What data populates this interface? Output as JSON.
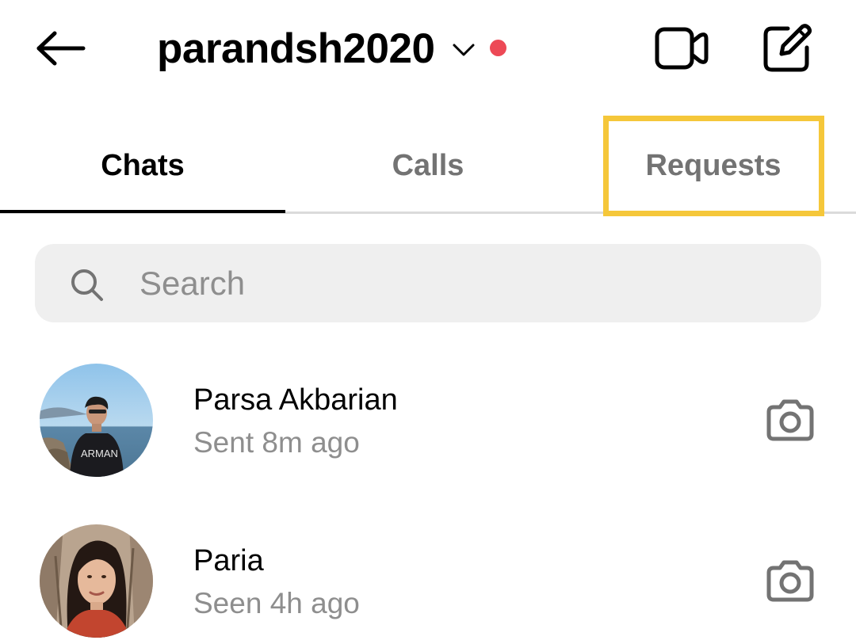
{
  "header": {
    "username": "parandsh2020",
    "back_icon": "arrow-left-icon",
    "switcher_icon": "chevron-down-icon",
    "video_icon": "video-camera-icon",
    "compose_icon": "edit-compose-icon",
    "notification_dot_color": "#ed4956"
  },
  "tabs": [
    {
      "label": "Chats",
      "active": true
    },
    {
      "label": "Calls",
      "active": false
    },
    {
      "label": "Requests",
      "active": false,
      "highlighted": true
    }
  ],
  "colors": {
    "highlight_box": "#f5c73a",
    "active_tab_text": "#000000",
    "inactive_tab_text": "#737373",
    "secondary_text": "#8e8e8e",
    "search_background": "#efefef"
  },
  "search": {
    "placeholder": "Search",
    "value": "",
    "icon": "search-icon"
  },
  "threads": [
    {
      "name": "Parsa Akbarian",
      "status": "Sent 8m ago",
      "avatar": "profile-photo",
      "action_icon": "camera-icon"
    },
    {
      "name": "Paria",
      "status": "Seen 4h ago",
      "avatar": "profile-photo",
      "action_icon": "camera-icon"
    }
  ]
}
